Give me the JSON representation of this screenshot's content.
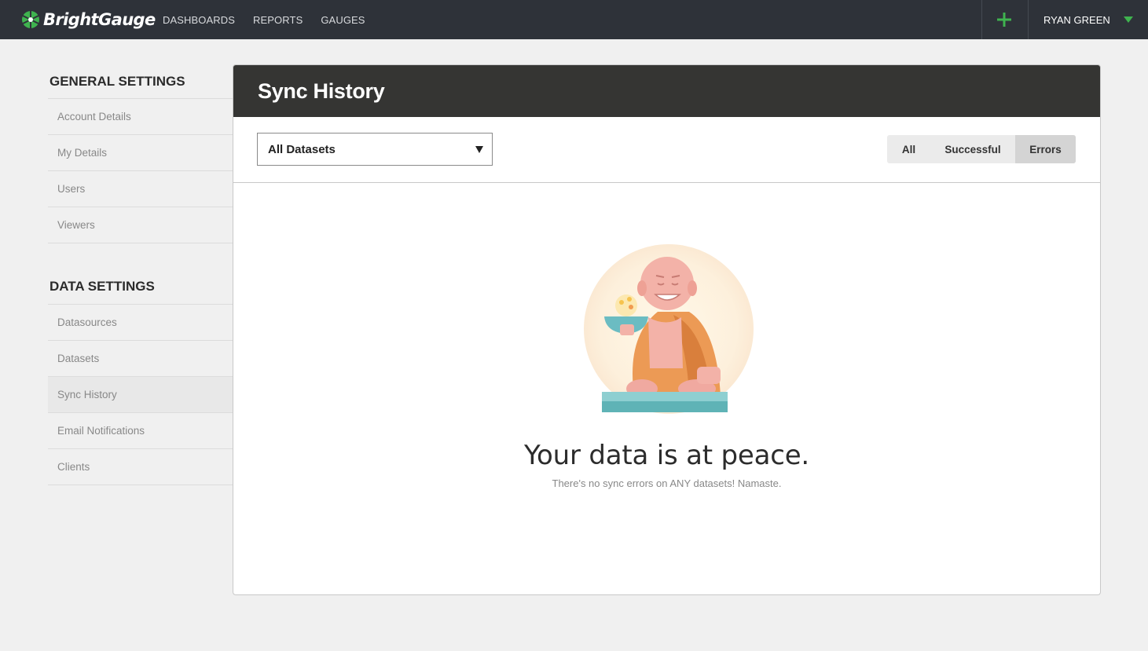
{
  "app": {
    "logo_text": "BrightGauge",
    "nav": [
      "DASHBOARDS",
      "REPORTS",
      "GAUGES"
    ],
    "user_name": "RYAN GREEN",
    "accent_color": "#3fb34f"
  },
  "sidebar": {
    "general_heading": "GENERAL SETTINGS",
    "general_items": [
      "Account Details",
      "My Details",
      "Users",
      "Viewers"
    ],
    "data_heading": "DATA SETTINGS",
    "data_items": [
      "Datasources",
      "Datasets",
      "Sync History",
      "Email Notifications",
      "Clients"
    ],
    "active_item": "Sync History"
  },
  "main": {
    "title": "Sync History",
    "dataset_select": "All Datasets",
    "filters": [
      "All",
      "Successful",
      "Errors"
    ],
    "active_filter": "Errors",
    "empty_title": "Your data is at peace.",
    "empty_subtitle": "There's no sync errors on ANY datasets! Namaste."
  }
}
